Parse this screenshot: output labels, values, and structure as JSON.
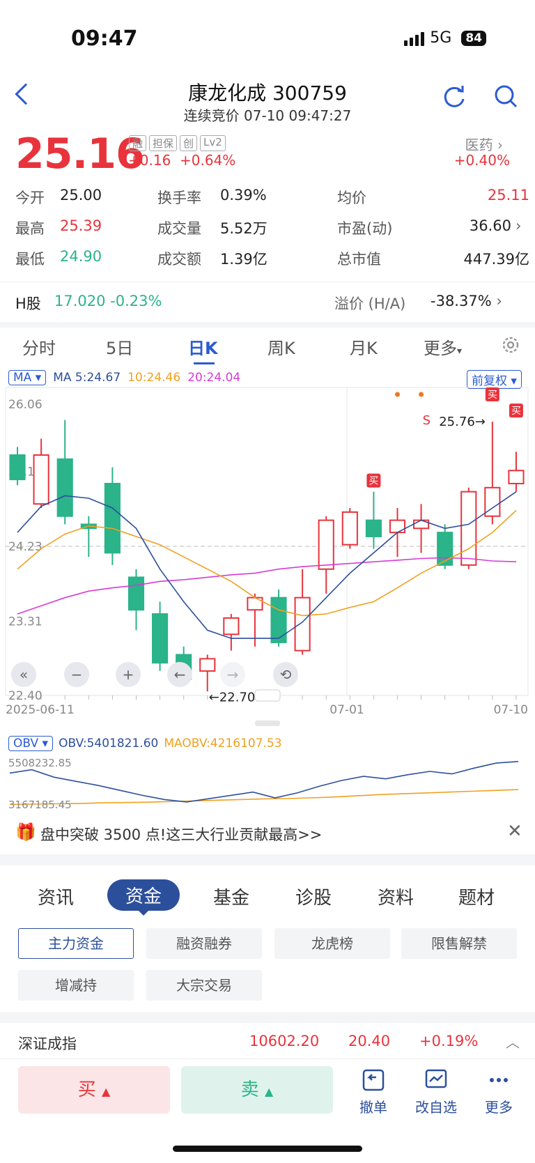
{
  "status": {
    "time": "09:47",
    "network": "5G",
    "battery": "84"
  },
  "header": {
    "title": "康龙化成 300759",
    "subtitle": "连续竞价 07-10 09:47:27"
  },
  "quote": {
    "price": "25.16",
    "change": "+0.16  +0.64%",
    "tags": [
      "融",
      "担保",
      "创",
      "Lv2"
    ],
    "sector_name": "医药",
    "sector_change": "+0.40%"
  },
  "stats": [
    {
      "label": "今开",
      "value": "25.00",
      "color": "#222"
    },
    {
      "label": "换手率",
      "value": "0.39%",
      "color": "#222"
    },
    {
      "label": "均价",
      "value": "25.11",
      "color": "#e8333c"
    },
    {
      "label": "最高",
      "value": "25.39",
      "color": "#e8333c"
    },
    {
      "label": "成交量",
      "value": "5.52万",
      "color": "#222"
    },
    {
      "label": "市盈(动)",
      "value": "36.60",
      "color": "#222"
    },
    {
      "label": "最低",
      "value": "24.90",
      "color": "#2bb38a"
    },
    {
      "label": "成交额",
      "value": "1.39亿",
      "color": "#222"
    },
    {
      "label": "总市值",
      "value": "447.39亿",
      "color": "#222"
    }
  ],
  "hshare": {
    "label": "H股",
    "price": "17.020",
    "change": "-0.23%",
    "premium_label": "溢价 (H/A)",
    "premium": "-38.37%"
  },
  "ktabs": [
    "分时",
    "5日",
    "日K",
    "周K",
    "月K",
    "更多"
  ],
  "ma": {
    "selector": "MA",
    "ma5": "MA 5:24.67",
    "ma10": "10:24.46",
    "ma20": "20:24.04",
    "adjust": "前复权"
  },
  "chart_data": {
    "type": "candlestick",
    "y_ticks": [
      "26.06",
      "25.15",
      "24.23",
      "23.31",
      "22.40"
    ],
    "ylim": [
      22.4,
      26.06
    ],
    "x_labels": [
      "2025-06-11",
      "07-01",
      "07-10"
    ],
    "annotations": {
      "high_label": "25.76→",
      "low_label": "←22.70",
      "buy_marker": "买",
      "sell_marker": "S"
    },
    "candles": [
      {
        "o": 25.35,
        "c": 25.05,
        "h": 25.45,
        "l": 24.98
      },
      {
        "o": 24.75,
        "c": 25.35,
        "h": 25.55,
        "l": 24.7
      },
      {
        "o": 25.3,
        "c": 24.6,
        "h": 25.78,
        "l": 24.5
      },
      {
        "o": 24.5,
        "c": 24.45,
        "h": 24.6,
        "l": 24.1
      },
      {
        "o": 25.0,
        "c": 24.15,
        "h": 25.2,
        "l": 24.0
      },
      {
        "o": 23.85,
        "c": 23.45,
        "h": 23.95,
        "l": 23.2
      },
      {
        "o": 23.4,
        "c": 22.8,
        "h": 23.55,
        "l": 22.7
      },
      {
        "o": 22.9,
        "c": 22.6,
        "h": 23.0,
        "l": 22.55
      },
      {
        "o": 22.7,
        "c": 22.85,
        "h": 22.9,
        "l": 22.45
      },
      {
        "o": 23.15,
        "c": 23.35,
        "h": 23.4,
        "l": 22.95
      },
      {
        "o": 23.45,
        "c": 23.6,
        "h": 23.65,
        "l": 23.0
      },
      {
        "o": 23.6,
        "c": 23.05,
        "h": 23.7,
        "l": 23.0
      },
      {
        "o": 22.95,
        "c": 23.6,
        "h": 23.95,
        "l": 22.9
      },
      {
        "o": 23.95,
        "c": 24.55,
        "h": 24.6,
        "l": 23.65
      },
      {
        "o": 24.25,
        "c": 24.65,
        "h": 24.7,
        "l": 24.2
      },
      {
        "o": 24.55,
        "c": 24.35,
        "h": 24.9,
        "l": 24.2
      },
      {
        "o": 24.4,
        "c": 24.55,
        "h": 24.7,
        "l": 24.1
      },
      {
        "o": 24.45,
        "c": 24.55,
        "h": 24.75,
        "l": 24.15
      },
      {
        "o": 24.4,
        "c": 24.0,
        "h": 24.5,
        "l": 23.95
      },
      {
        "o": 24.0,
        "c": 24.9,
        "h": 24.95,
        "l": 23.95
      },
      {
        "o": 24.6,
        "c": 24.95,
        "h": 25.76,
        "l": 24.5
      },
      {
        "o": 25.0,
        "c": 25.16,
        "h": 25.39,
        "l": 24.9
      }
    ],
    "ma5": [
      24.4,
      24.72,
      24.85,
      24.82,
      24.7,
      24.45,
      23.95,
      23.55,
      23.2,
      23.1,
      23.1,
      23.1,
      23.3,
      23.6,
      23.9,
      24.15,
      24.4,
      24.55,
      24.45,
      24.5,
      24.7,
      24.9
    ],
    "ma10": [
      23.95,
      24.2,
      24.38,
      24.48,
      24.45,
      24.35,
      24.25,
      24.1,
      23.95,
      23.8,
      23.6,
      23.45,
      23.38,
      23.4,
      23.48,
      23.55,
      23.72,
      23.9,
      24.05,
      24.2,
      24.4,
      24.67
    ],
    "ma20": [
      23.4,
      23.5,
      23.6,
      23.68,
      23.72,
      23.75,
      23.8,
      23.82,
      23.85,
      23.88,
      23.9,
      23.95,
      23.98,
      24.0,
      24.02,
      24.04,
      24.06,
      24.08,
      24.09,
      24.08,
      24.05,
      24.04
    ],
    "obv": {
      "selector": "OBV",
      "obv_label": "OBV:5401821.60",
      "maobv_label": "MAOBV:4216107.53",
      "top": "5508232.85",
      "bottom": "3167185.45"
    }
  },
  "notice": {
    "text": "盘中突破 3500 点!这三大行业贡献最高>>"
  },
  "ftabs": [
    "资讯",
    "资金",
    "基金",
    "诊股",
    "资料",
    "题材"
  ],
  "chips": [
    "主力资金",
    "融资融券",
    "龙虎榜",
    "限售解禁",
    "增减持",
    "大宗交易"
  ],
  "index": {
    "name": "深证成指",
    "value": "10602.20",
    "change": "20.40",
    "pct": "+0.19%"
  },
  "actions": {
    "buy": "买",
    "sell": "卖",
    "cancel": "撤单",
    "edit": "改自选",
    "more": "更多"
  }
}
